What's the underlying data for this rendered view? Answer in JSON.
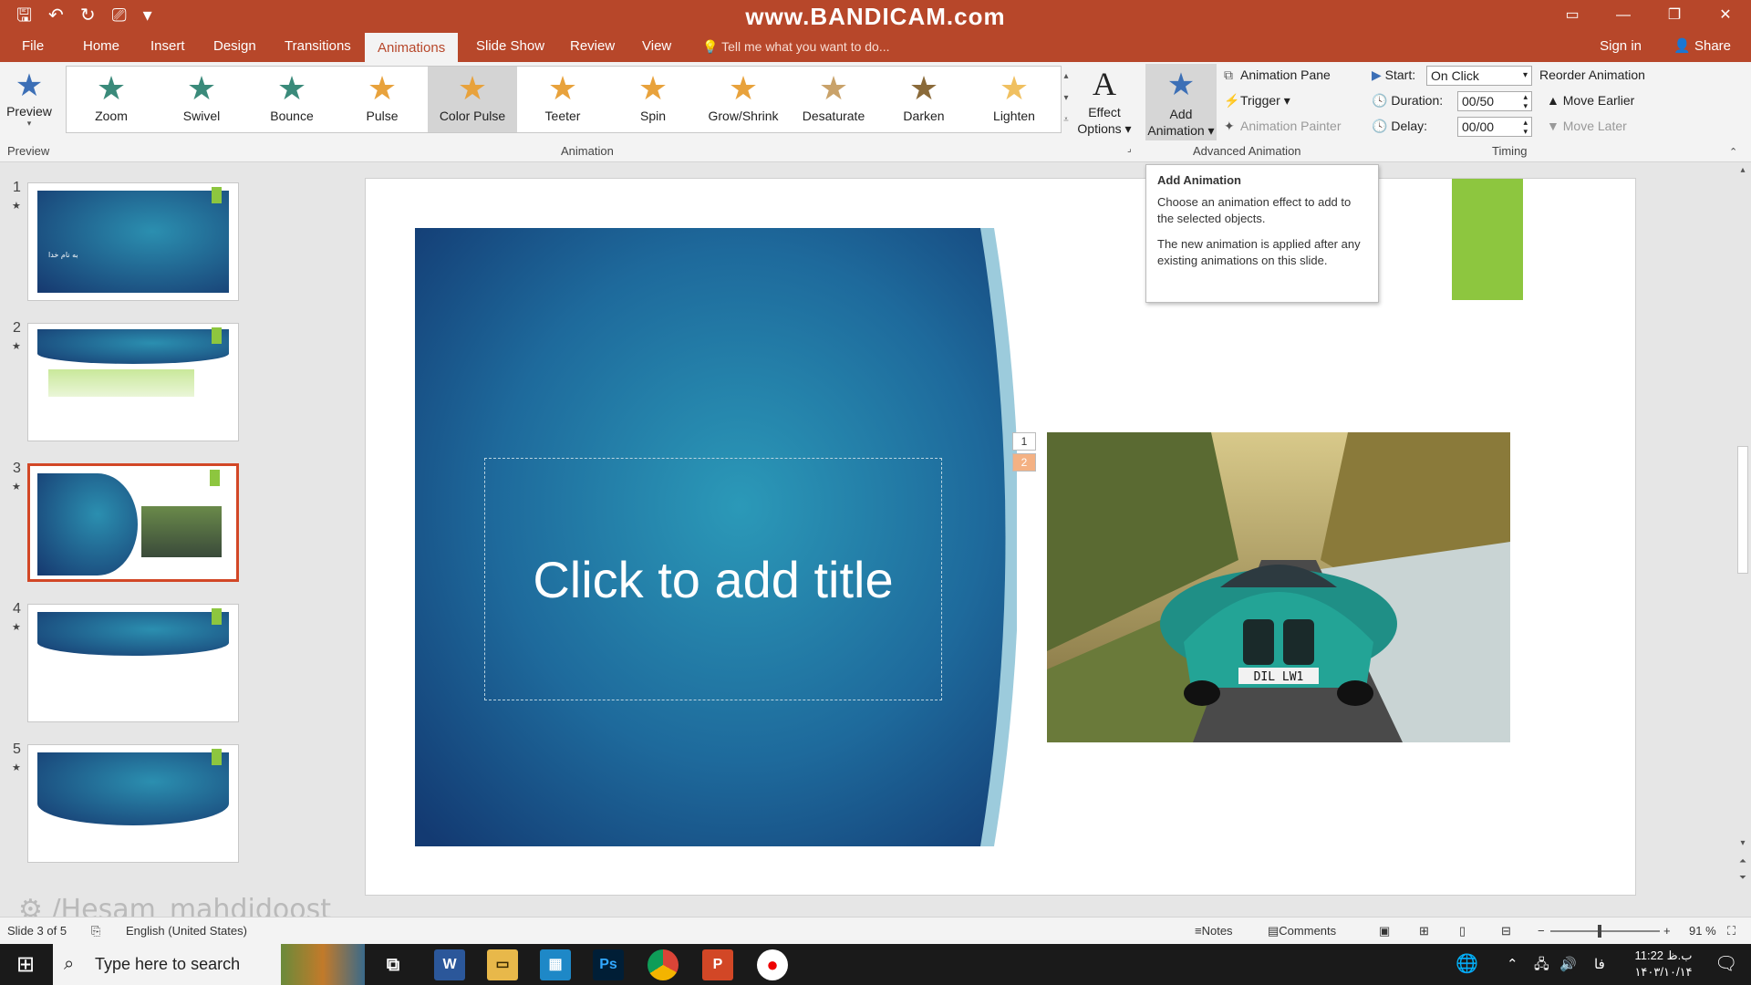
{
  "window": {
    "watermark": "www.BANDICAM.com"
  },
  "menu": {
    "file": "File",
    "home": "Home",
    "insert": "Insert",
    "design": "Design",
    "transitions": "Transitions",
    "animations": "Animations",
    "slideshow": "Slide Show",
    "review": "Review",
    "view": "View",
    "tellme": "Tell me what you want to do...",
    "signin": "Sign in",
    "share": "Share"
  },
  "ribbon": {
    "preview_label": "Preview",
    "preview_group": "Preview",
    "animation_group": "Animation",
    "effects": [
      {
        "label": "Zoom",
        "icon": "zoom-star-icon",
        "color": "#3a8a7a"
      },
      {
        "label": "Swivel",
        "icon": "swivel-star-icon",
        "color": "#3a8a7a"
      },
      {
        "label": "Bounce",
        "icon": "bounce-star-icon",
        "color": "#3a8a7a"
      },
      {
        "label": "Pulse",
        "icon": "pulse-star-icon",
        "color": "#e8a23c"
      },
      {
        "label": "Color Pulse",
        "icon": "color-pulse-star-icon",
        "color": "#e8a23c"
      },
      {
        "label": "Teeter",
        "icon": "teeter-star-icon",
        "color": "#e8a23c"
      },
      {
        "label": "Spin",
        "icon": "spin-star-icon",
        "color": "#e8a23c"
      },
      {
        "label": "Grow/Shrink",
        "icon": "grow-shrink-star-icon",
        "color": "#e8a23c"
      },
      {
        "label": "Desaturate",
        "icon": "desaturate-star-icon",
        "color": "#c9a26a"
      },
      {
        "label": "Darken",
        "icon": "darken-star-icon",
        "color": "#8a6a3a"
      },
      {
        "label": "Lighten",
        "icon": "lighten-star-icon",
        "color": "#f0c060"
      }
    ],
    "selected_effect": "Color Pulse",
    "effect_options_1": "Effect",
    "effect_options_2": "Options",
    "add_animation_1": "Add",
    "add_animation_2": "Animation",
    "animation_pane": "Animation Pane",
    "trigger": "Trigger",
    "animation_painter": "Animation Painter",
    "advanced_group": "Advanced Animation",
    "start_label": "Start:",
    "start_value": "On Click",
    "duration_label": "Duration:",
    "duration_value": "00/50",
    "delay_label": "Delay:",
    "delay_value": "00/00",
    "timing_group": "Timing",
    "reorder_title": "Reorder Animation",
    "move_earlier": "Move Earlier",
    "move_later": "Move Later"
  },
  "slides": [
    {
      "num": "1",
      "star": "★",
      "thumb_text": "به نام خدا"
    },
    {
      "num": "2",
      "star": "★"
    },
    {
      "num": "3",
      "star": "★"
    },
    {
      "num": "4",
      "star": "★"
    },
    {
      "num": "5",
      "star": "★"
    }
  ],
  "slide": {
    "title_placeholder": "Click to add title",
    "anim_tag_1": "1",
    "anim_tag_2": "2",
    "plate": "DIL LW1"
  },
  "tooltip": {
    "title": "Add Animation",
    "p1": "Choose an animation effect to add to the selected objects.",
    "p2": "The new animation is applied after any existing animations on this slide."
  },
  "status": {
    "slide_info": "Slide 3 of 5",
    "language": "English (United States)",
    "notes": "Notes",
    "comments": "Comments",
    "zoom": "91 %",
    "user_watermark": "/Hesam_mahdidoost"
  },
  "taskbar": {
    "search_placeholder": "Type here to search",
    "time": "11:22 ب.ظ",
    "date": "۱۴۰۳/۱۰/۱۴",
    "lang": "فا"
  },
  "colors": {
    "accent": "#b7472a",
    "slide_blue_dark": "#16386f",
    "slide_blue_light": "#2b8fb0",
    "green": "#8dc63f"
  }
}
